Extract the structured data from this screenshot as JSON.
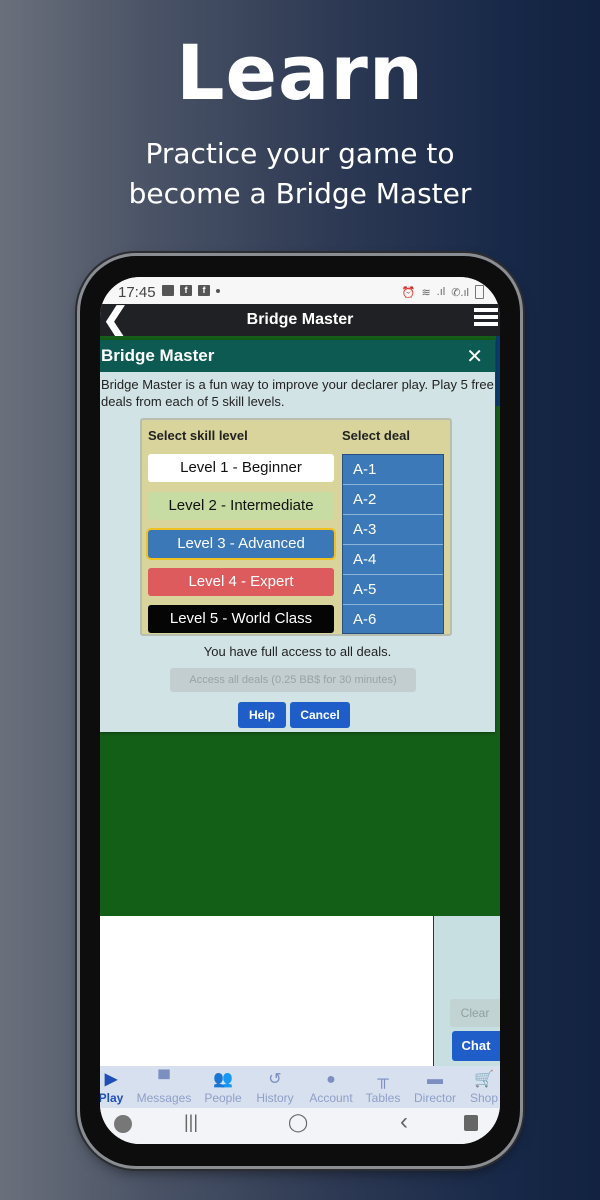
{
  "hero": {
    "title": "Learn",
    "subtitle_line1": "Practice your game to",
    "subtitle_line2": "become a Bridge Master"
  },
  "statusbar": {
    "time": "17:45",
    "left_icons": [
      "image-icon",
      "facebook-icon",
      "facebook-icon",
      "dot-icon"
    ],
    "right_icons": [
      "alarm-icon",
      "wifi-icon",
      "signal-icon",
      "call-signal-icon",
      "battery-icon"
    ]
  },
  "appbar": {
    "title": "Bridge Master",
    "back_glyph": "❮",
    "menu_icon": "hamburger-icon"
  },
  "dialog": {
    "title": "Bridge Master",
    "close_glyph": "✕",
    "description": "Bridge Master is a fun way to improve your declarer play. Play 5 free deals from each of 5 skill levels.",
    "skill_header": "Select skill level",
    "deal_header": "Select deal",
    "levels": [
      {
        "label": "Level 1 - Beginner",
        "bg": "#ffffff",
        "fg": "#111111"
      },
      {
        "label": "Level 2 - Intermediate",
        "bg": "#c6dca2",
        "fg": "#111111"
      },
      {
        "label": "Level 3 - Advanced",
        "bg": "#3a78b8",
        "fg": "#ffffff",
        "selected": true
      },
      {
        "label": "Level 4 - Expert",
        "bg": "#dd5b5c",
        "fg": "#ffffff"
      },
      {
        "label": "Level 5 - World Class",
        "bg": "#050505",
        "fg": "#ffffff"
      }
    ],
    "deals": [
      "A-1",
      "A-2",
      "A-3",
      "A-4",
      "A-5",
      "A-6"
    ],
    "access_text": "You have full access to all deals.",
    "access_button": "Access all deals (0.25 BB$ for 30 minutes)",
    "help_button": "Help",
    "cancel_button": "Cancel"
  },
  "chat": {
    "clear_button": "Clear",
    "chat_button": "Chat"
  },
  "tabs": [
    {
      "label": "Play",
      "icon": "▶",
      "icon_name": "play-icon",
      "active": true
    },
    {
      "label": "Messages",
      "icon": "▀",
      "icon_name": "message-icon"
    },
    {
      "label": "People",
      "icon": "👥",
      "icon_name": "people-icon"
    },
    {
      "label": "History",
      "icon": "↺",
      "icon_name": "history-icon"
    },
    {
      "label": "Account",
      "icon": "●",
      "icon_name": "account-icon"
    },
    {
      "label": "Tables",
      "icon": "╥",
      "icon_name": "table-icon"
    },
    {
      "label": "Director",
      "icon": "▬",
      "icon_name": "director-icon"
    },
    {
      "label": "Shop",
      "icon": "🛒",
      "icon_name": "cart-icon"
    }
  ],
  "navbar": {
    "recents": "|||",
    "home": "◯",
    "back": "‹"
  },
  "colors": {
    "dialog_header": "#0c5a52",
    "table_green": "#145f18",
    "accent_blue": "#1f5ec9",
    "selected_outline": "#f0c020"
  }
}
